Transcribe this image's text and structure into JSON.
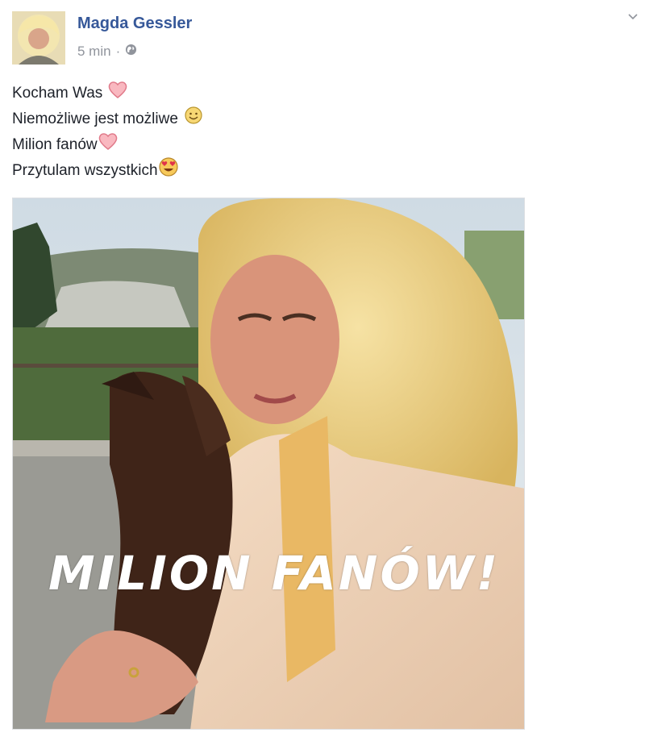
{
  "post": {
    "author": "Magda Gessler",
    "timestamp": "5 min",
    "separator": "·",
    "privacy_icon": "globe-icon",
    "menu_icon": "chevron-down-icon",
    "lines": [
      {
        "text": "Kocham Was",
        "emoji": "heart-emoji"
      },
      {
        "text": "Niemożliwe jest możliwe",
        "emoji": "smile-emoji"
      },
      {
        "text": "Milion fanów",
        "emoji": "heart-emoji"
      },
      {
        "text": "Przytulam wszystkich",
        "emoji": "heart-eyes-emoji"
      }
    ],
    "photo_caption": "MILION FANÓW!",
    "colors": {
      "author": "#365899",
      "meta": "#90949c",
      "heart": "#f7a6b0"
    }
  }
}
